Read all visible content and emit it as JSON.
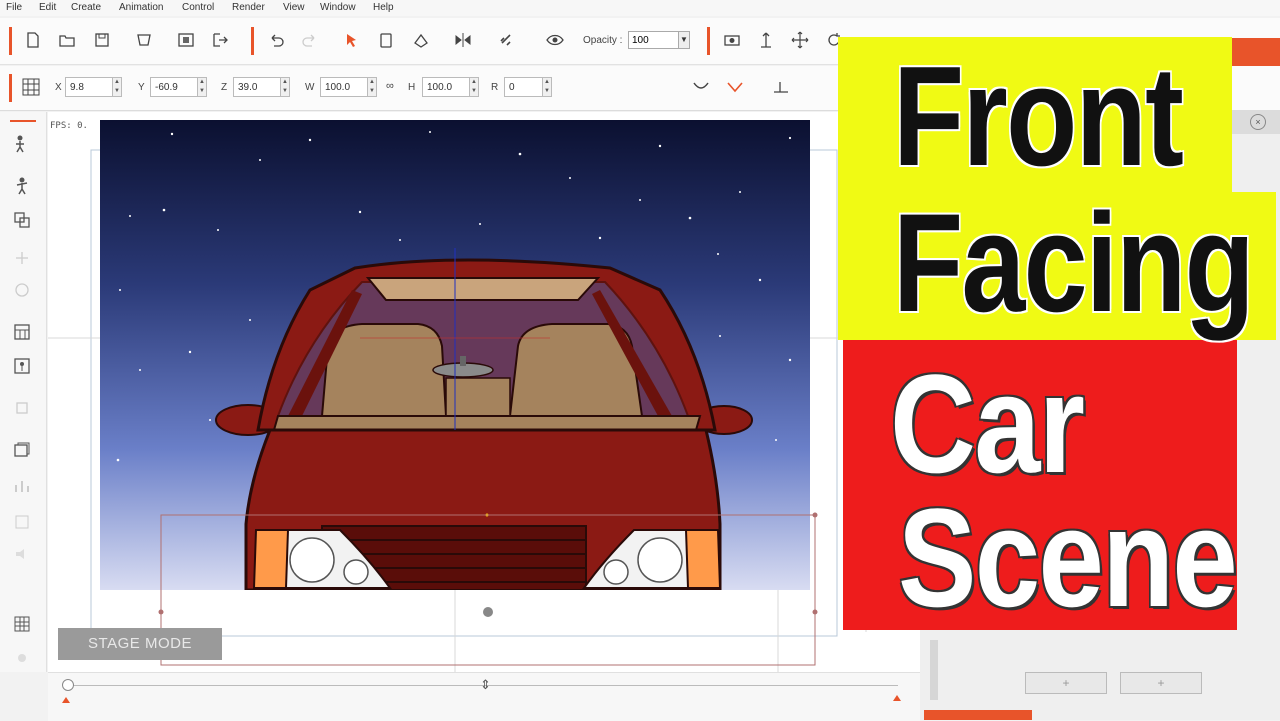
{
  "menu": [
    "File",
    "Edit",
    "Create",
    "Animation",
    "Control",
    "Render",
    "View",
    "Window",
    "Help"
  ],
  "toolbar": {
    "opacity_label": "Opacity :",
    "opacity_value": "100"
  },
  "transform": {
    "x_label": "X",
    "x_value": "9.8",
    "y_label": "Y",
    "y_value": "-60.9",
    "z_label": "Z",
    "z_value": "39.0",
    "w_label": "W",
    "w_value": "100.0",
    "h_label": "H",
    "h_value": "100.0",
    "r_label": "R",
    "r_value": "0"
  },
  "stage": {
    "fps_label": "FPS: 0.",
    "mode_label": "STAGE MODE"
  },
  "title": {
    "line1": "Front",
    "line2": "Facing",
    "line3": "Car",
    "line4": "Scene"
  },
  "colors": {
    "accent": "#e8542a",
    "title_yellow": "#f0fa14",
    "title_red": "#ee1c1c",
    "car_body": "#8b1a14",
    "sky_top": "#0b1030",
    "sky_bottom": "#c8cfee"
  }
}
